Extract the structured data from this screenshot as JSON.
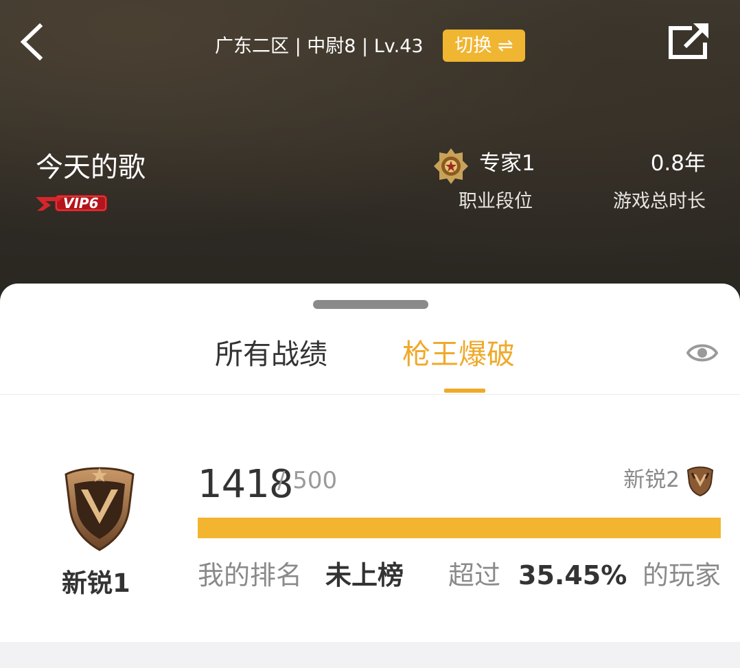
{
  "header": {
    "server_info": "广东二区 | 中尉8 | Lv.43",
    "switch_label": "切换 ⇌",
    "username": "今天的歌",
    "vip_badge": "VIP6",
    "rank_value": "专家1",
    "rank_label": "职业段位",
    "playtime_value": "0.8年",
    "playtime_label": "游戏总时长"
  },
  "tabs": [
    {
      "label": "所有战绩",
      "active": false
    },
    {
      "label": "枪王爆破",
      "active": true
    }
  ],
  "stats": {
    "tier_name": "新锐1",
    "score_current": "1418",
    "score_target": "/ 500",
    "next_tier": "新锐2",
    "progress_fraction": 1.0,
    "my_rank_label": "我的排名",
    "my_rank_value": "未上榜",
    "exceed_label": "超过",
    "exceed_value": "35.45%",
    "players_label": "的玩家"
  },
  "colors": {
    "accent": "#f0a92a",
    "progress": "#f3b52f",
    "header_bg": "#2e2a24"
  },
  "icons": {
    "back": "chevron-left-icon",
    "share": "share-icon",
    "visibility": "eye-icon",
    "rank_medal": "gold-medal-icon",
    "tier_emblem": "bronze-shield-icon"
  }
}
